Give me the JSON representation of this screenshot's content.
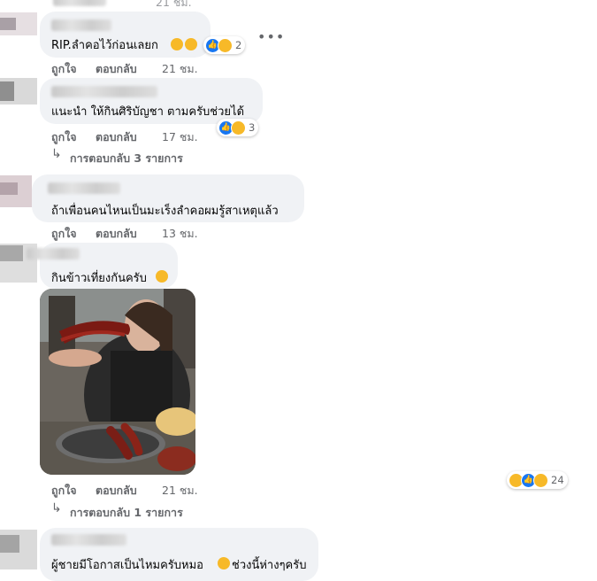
{
  "top_time": "21 ชม.",
  "comments": [
    {
      "text": "RIP.ลำคอไว้ก่อนเลยก",
      "reactions": {
        "count": "2"
      },
      "like": "ถูกใจ",
      "reply": "ตอบกลับ",
      "time": "21 ชม."
    },
    {
      "text": "แนะนำ ให้กินศิริบัญชา ตามครับช่วยได้",
      "reactions": {
        "count": "3"
      },
      "like": "ถูกใจ",
      "reply": "ตอบกลับ",
      "time": "17 ชม.",
      "replies_link": "การตอบกลับ 3 รายการ"
    },
    {
      "text": "ถ้าเพื่อนคนไหนเป็นมะเร็งลำคอผมรู้สาเหตุแล้ว",
      "like": "ถูกใจ",
      "reply": "ตอบกลับ",
      "time": "13 ชม."
    },
    {
      "text": "กินข้าวเที่ยงกันครับ",
      "reactions": {
        "count": "24"
      },
      "like": "ถูกใจ",
      "reply": "ตอบกลับ",
      "time": "21 ชม.",
      "replies_link": "การตอบกลับ 1 รายการ"
    },
    {
      "text": "ผู้ชายมีโอกาสเป็นไหมครับหมอ",
      "text_after": "ช่วงนี้ห่างๆครับ"
    }
  ],
  "icons": {
    "more": "more-options-icon",
    "reply_arrow": "reply-arrow-icon"
  },
  "colors": {
    "bubble": "#f0f2f5",
    "meta": "#65676b",
    "like_blue": "#1877f2",
    "emoji_yellow": "#f7b928"
  }
}
